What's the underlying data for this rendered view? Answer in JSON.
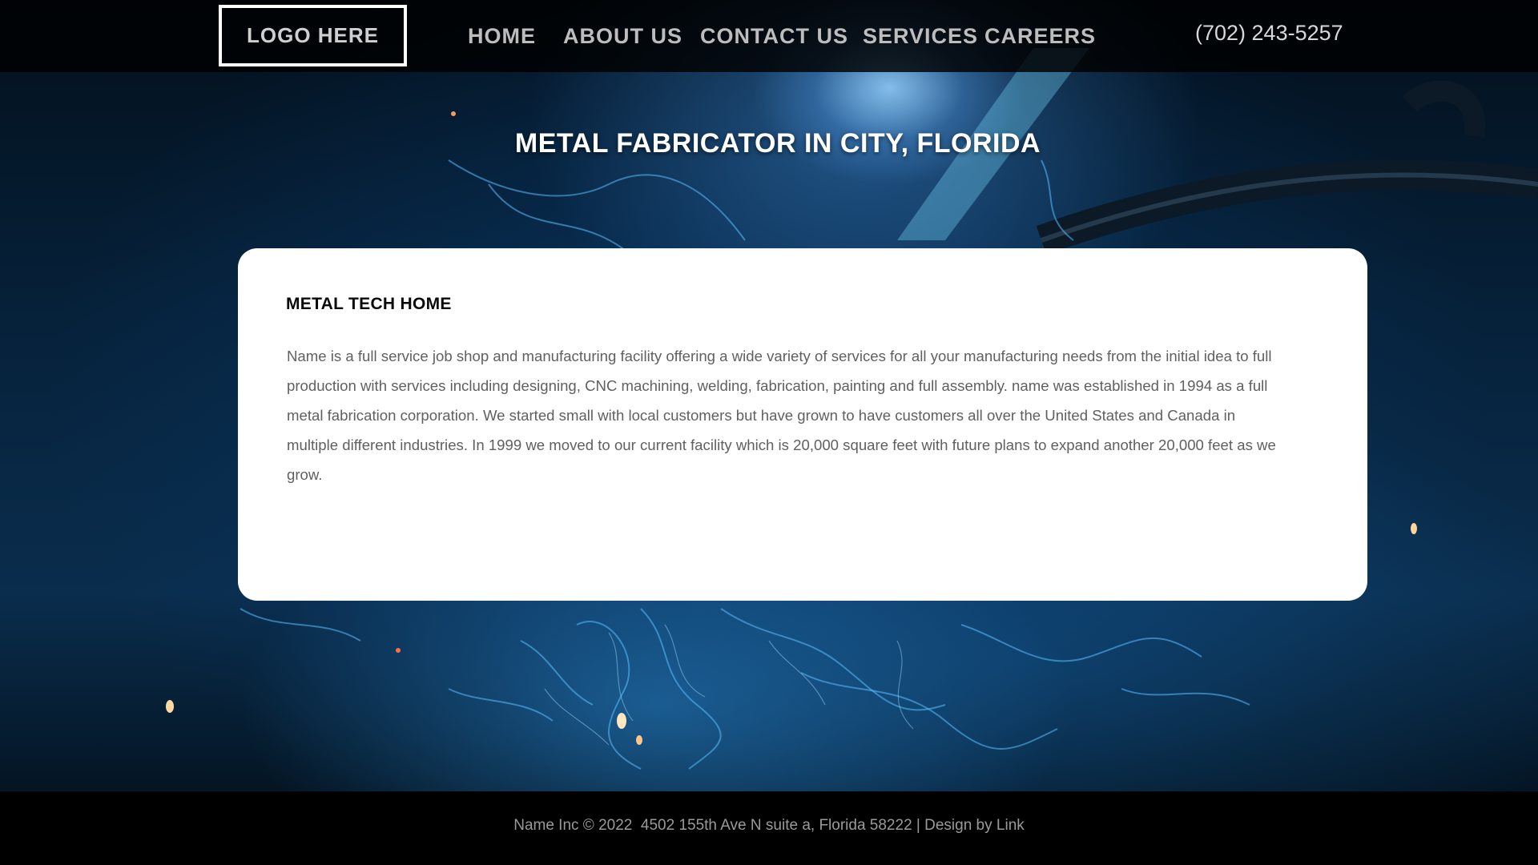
{
  "header": {
    "logo_label": "LOGO HERE",
    "nav": [
      {
        "label": "HOME"
      },
      {
        "label": "ABOUT US"
      },
      {
        "label": "CONTACT US"
      },
      {
        "label": "SERVICES"
      },
      {
        "label": "CAREERS"
      }
    ],
    "phone": "(702) 243-5257"
  },
  "hero": {
    "title": "METAL FABRICATOR IN CITY, FLORIDA"
  },
  "card": {
    "heading": "METAL TECH HOME",
    "body": "Name is a full service job shop and manufacturing facility offering a wide variety of services for all your manufacturing needs from the initial idea to full production with services including designing, CNC machining, welding, fabrication, painting and full assembly. name was established in 1994 as a full metal fabrication corporation. We started small with local customers but have grown to have customers all over the United States and Canada in multiple different industries. In 1999 we moved to our current facility which is 20,000 square feet with future plans to expand another 20,000 feet as we grow."
  },
  "footer": {
    "text": "Name Inc © 2022  4502 155th Ave N suite a, Florida 58222 | Design by ",
    "link_label": "Link"
  },
  "colors": {
    "header_bg": "#000000",
    "card_bg": "#ffffff",
    "footer_bg": "#000000",
    "accent_glow": "#3a9ad9"
  }
}
